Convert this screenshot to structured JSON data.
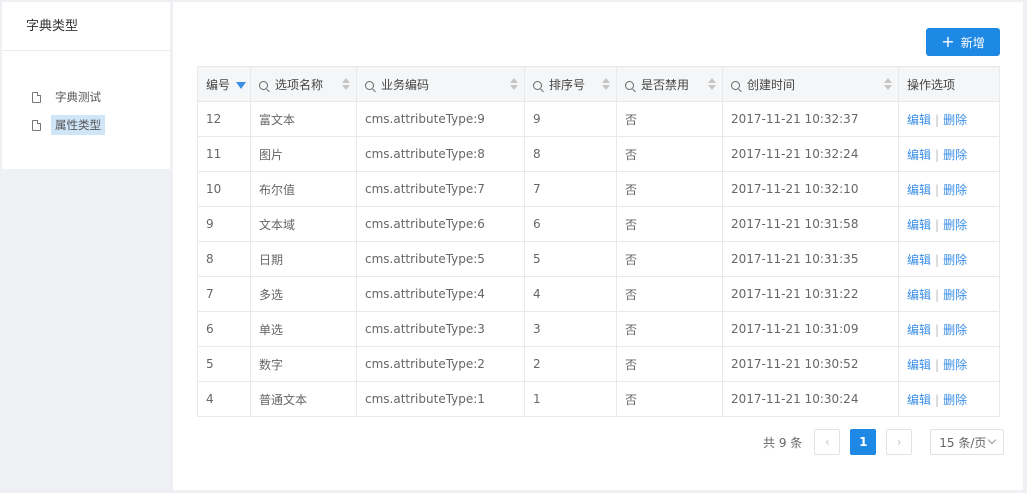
{
  "sidebar": {
    "title": "字典类型",
    "items": [
      {
        "label": "字典测试",
        "selected": false
      },
      {
        "label": "属性类型",
        "selected": true
      }
    ]
  },
  "toolbar": {
    "add_label": "新增",
    "add_icon": "plus-icon"
  },
  "table": {
    "columns": [
      {
        "label": "编号",
        "search": false,
        "sort": "desc-active"
      },
      {
        "label": "选项名称",
        "search": true,
        "sort": "both"
      },
      {
        "label": "业务编码",
        "search": true,
        "sort": "both"
      },
      {
        "label": "排序号",
        "search": true,
        "sort": "both"
      },
      {
        "label": "是否禁用",
        "search": true,
        "sort": "both"
      },
      {
        "label": "创建时间",
        "search": true,
        "sort": "both"
      },
      {
        "label": "操作选项",
        "search": false,
        "sort": "none"
      }
    ],
    "rows": [
      {
        "id": "12",
        "name": "富文本",
        "code": "cms.attributeType:9",
        "order": "9",
        "disabled": "否",
        "created": "2017-11-21 10:32:37"
      },
      {
        "id": "11",
        "name": "图片",
        "code": "cms.attributeType:8",
        "order": "8",
        "disabled": "否",
        "created": "2017-11-21 10:32:24"
      },
      {
        "id": "10",
        "name": "布尔值",
        "code": "cms.attributeType:7",
        "order": "7",
        "disabled": "否",
        "created": "2017-11-21 10:32:10"
      },
      {
        "id": "9",
        "name": "文本域",
        "code": "cms.attributeType:6",
        "order": "6",
        "disabled": "否",
        "created": "2017-11-21 10:31:58"
      },
      {
        "id": "8",
        "name": "日期",
        "code": "cms.attributeType:5",
        "order": "5",
        "disabled": "否",
        "created": "2017-11-21 10:31:35"
      },
      {
        "id": "7",
        "name": "多选",
        "code": "cms.attributeType:4",
        "order": "4",
        "disabled": "否",
        "created": "2017-11-21 10:31:22"
      },
      {
        "id": "6",
        "name": "单选",
        "code": "cms.attributeType:3",
        "order": "3",
        "disabled": "否",
        "created": "2017-11-21 10:31:09"
      },
      {
        "id": "5",
        "name": "数字",
        "code": "cms.attributeType:2",
        "order": "2",
        "disabled": "否",
        "created": "2017-11-21 10:30:52"
      },
      {
        "id": "4",
        "name": "普通文本",
        "code": "cms.attributeType:1",
        "order": "1",
        "disabled": "否",
        "created": "2017-11-21 10:30:24"
      }
    ],
    "ops": {
      "edit": "编辑",
      "delete": "删除",
      "separator": "|"
    }
  },
  "pagination": {
    "total_text": "共 9 条",
    "prev": "‹",
    "next": "›",
    "current_page": "1",
    "page_size": "15 条/页"
  },
  "colors": {
    "accent": "#1e88e5",
    "link": "#3a8ee6"
  }
}
